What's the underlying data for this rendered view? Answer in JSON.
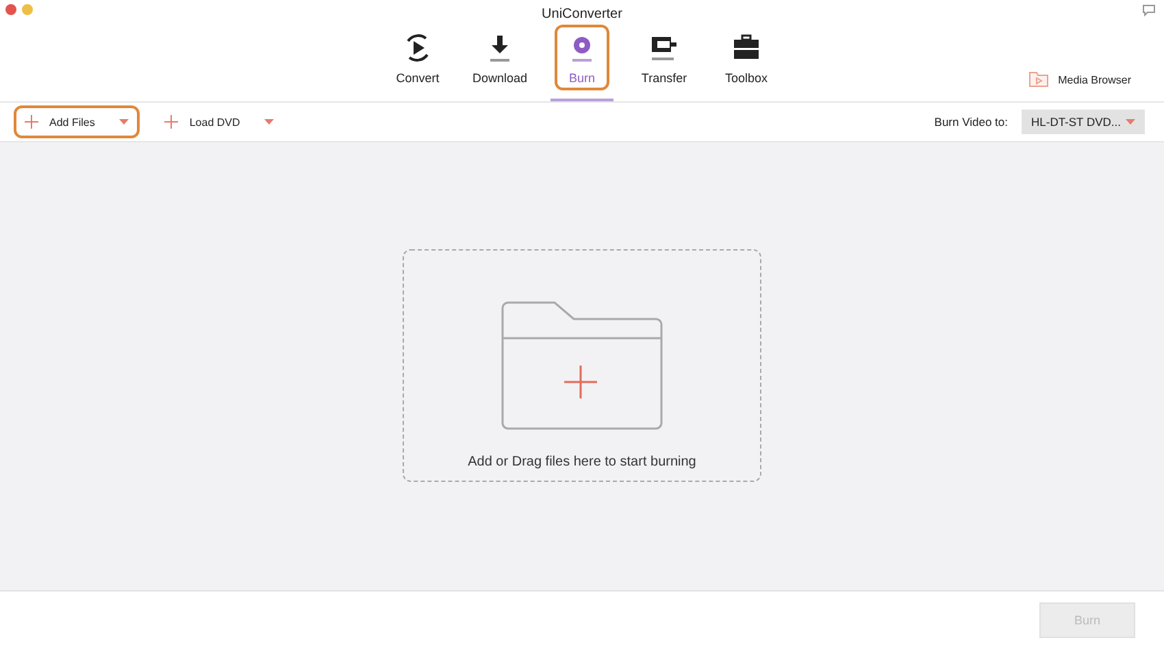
{
  "window": {
    "title": "UniConverter"
  },
  "tabs": [
    {
      "label": "Convert",
      "selected": false,
      "highlighted": false
    },
    {
      "label": "Download",
      "selected": false,
      "highlighted": false
    },
    {
      "label": "Burn",
      "selected": true,
      "highlighted": true
    },
    {
      "label": "Transfer",
      "selected": false,
      "highlighted": false
    },
    {
      "label": "Toolbox",
      "selected": false,
      "highlighted": false
    }
  ],
  "media_browser": {
    "label": "Media Browser"
  },
  "toolbar": {
    "buttons": [
      {
        "label": "Add Files",
        "highlighted": true
      },
      {
        "label": "Load DVD",
        "highlighted": false
      }
    ],
    "burn_to_label": "Burn Video to:",
    "burn_to_value": "HL-DT-ST DVD..."
  },
  "drop_zone": {
    "text": "Add or Drag files here to start burning"
  },
  "footer": {
    "burn_button": {
      "label": "Burn",
      "disabled": true
    }
  }
}
